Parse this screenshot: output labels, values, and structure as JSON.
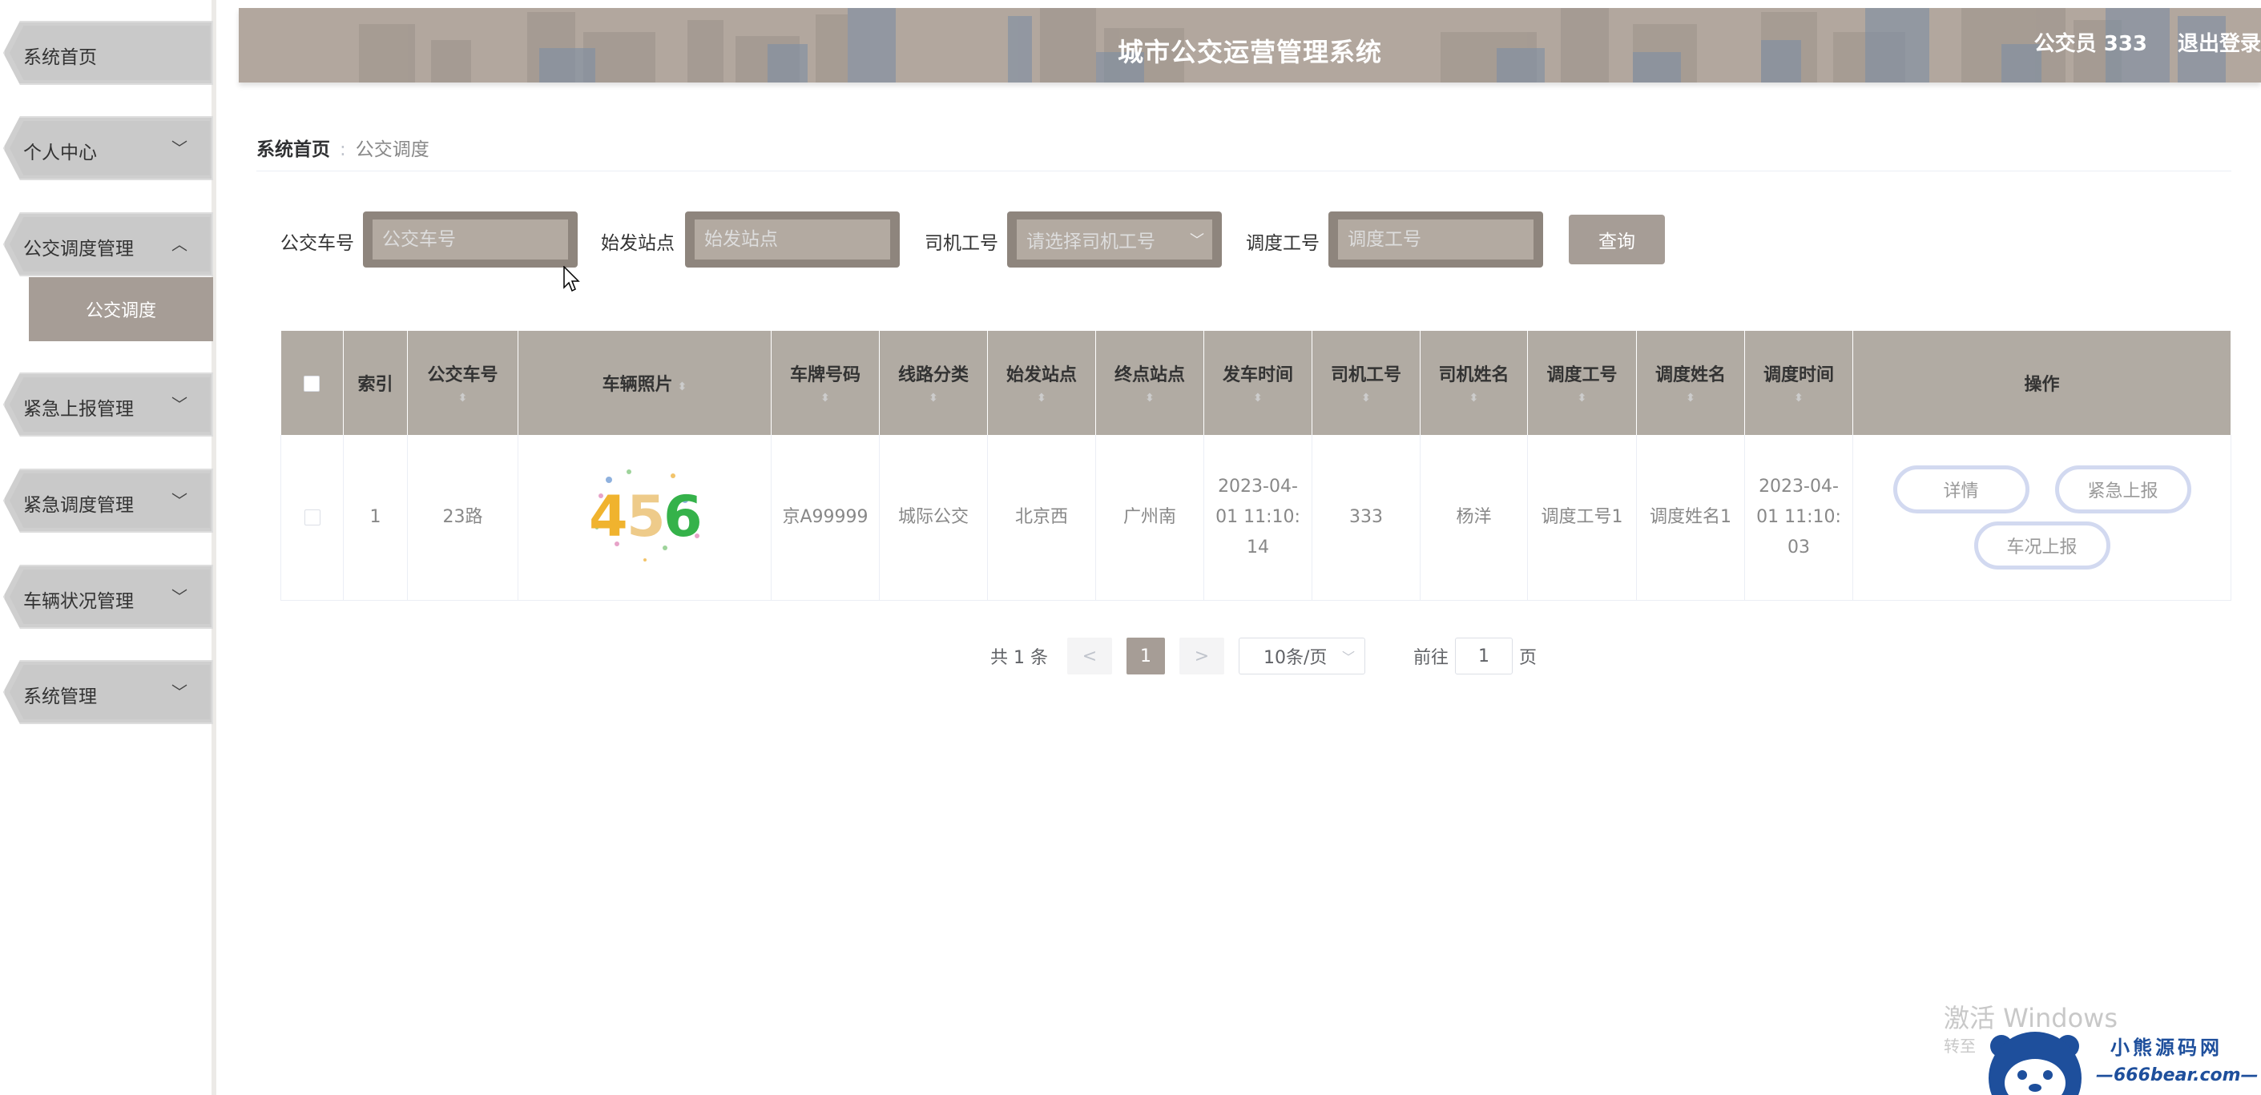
{
  "header": {
    "title": "城市公交运营管理系统",
    "user": "公交员 333",
    "logout": "退出登录"
  },
  "sidebar": {
    "items": [
      {
        "label": "系统首页",
        "chevron": ""
      },
      {
        "label": "个人中心",
        "chevron": "﹀"
      },
      {
        "label": "公交调度管理",
        "chevron": "︿"
      },
      {
        "label": "紧急上报管理",
        "chevron": "﹀"
      },
      {
        "label": "紧急调度管理",
        "chevron": "﹀"
      },
      {
        "label": "车辆状况管理",
        "chevron": "﹀"
      },
      {
        "label": "系统管理",
        "chevron": "﹀"
      }
    ],
    "sub_active": "公交调度"
  },
  "breadcrumb": {
    "home": "系统首页",
    "separator": ":",
    "current": "公交调度"
  },
  "search": {
    "bus_no": {
      "label": "公交车号",
      "placeholder": "公交车号"
    },
    "start_station": {
      "label": "始发站点",
      "placeholder": "始发站点"
    },
    "driver_no": {
      "label": "司机工号",
      "placeholder": "请选择司机工号"
    },
    "dispatch_no": {
      "label": "调度工号",
      "placeholder": "调度工号"
    },
    "query_button": "查询"
  },
  "table": {
    "headers": {
      "index": "索引",
      "bus_no": "公交车号",
      "photo": "车辆照片",
      "plate": "车牌号码",
      "route_type": "线路分类",
      "start": "始发站点",
      "end": "终点站点",
      "depart_time": "发车时间",
      "driver_no": "司机工号",
      "driver_name": "司机姓名",
      "dispatch_no": "调度工号",
      "dispatch_name": "调度姓名",
      "dispatch_time": "调度时间",
      "actions": "操作"
    },
    "sort_icon": "⬍",
    "rows": [
      {
        "index": "1",
        "bus_no": "23路",
        "photo_text": "456",
        "plate": "京A99999",
        "route_type": "城际公交",
        "start": "北京西",
        "end": "广州南",
        "depart_time": "2023-04-01 11:10:14",
        "driver_no": "333",
        "driver_name": "杨洋",
        "dispatch_no": "调度工号1",
        "dispatch_name": "调度姓名1",
        "dispatch_time": "2023-04-01 11:10:03",
        "actions": {
          "detail": "详情",
          "emergency": "紧急上报",
          "vehicle": "车况上报"
        }
      }
    ]
  },
  "pagination": {
    "total": "共 1 条",
    "prev": "<",
    "page": "1",
    "next": ">",
    "page_size": "10条/页",
    "goto_label": "前往",
    "goto_value": "1",
    "goto_suffix": "页"
  },
  "watermark": {
    "line1": "激活 Windows",
    "line2": "转至",
    "brand_name": "小熊源码网",
    "brand_url": "—666bear.com—"
  },
  "colors": {
    "accent": "#a69d96",
    "header_bg": "#b2a79e",
    "table_header": "#b1aba3",
    "sidebar_item": "#c9c9c9"
  }
}
